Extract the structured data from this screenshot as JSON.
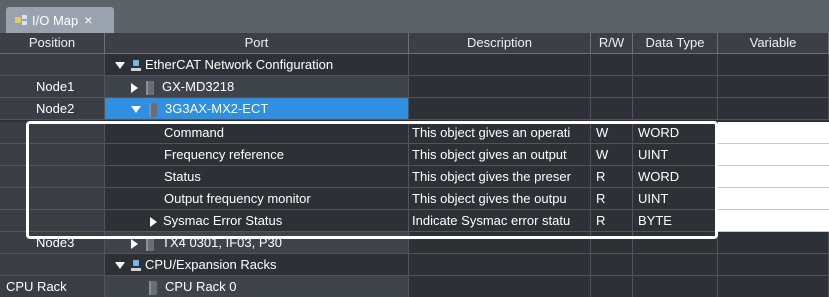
{
  "tab": {
    "label": "I/O Map",
    "close": "×",
    "icon": "io-map-icon"
  },
  "columns": [
    "Position",
    "Port",
    "Description",
    "R/W",
    "Data Type",
    "Variable"
  ],
  "rows": [
    {
      "position": "",
      "port": "EtherCAT Network Configuration",
      "description": "",
      "rw": "",
      "type": "",
      "kind": "group",
      "expander": "down"
    },
    {
      "position": "Node1",
      "port": "GX-MD3218",
      "description": "",
      "rw": "",
      "type": "",
      "kind": "device",
      "expander": "right"
    },
    {
      "position": "Node2",
      "port": "3G3AX-MX2-ECT",
      "description": "",
      "rw": "",
      "type": "",
      "kind": "device",
      "expander": "down",
      "selected": true
    },
    {
      "position": "",
      "port": "Command",
      "description": "This object gives an operati",
      "rw": "W",
      "type": "WORD",
      "kind": "object"
    },
    {
      "position": "",
      "port": "Frequency reference",
      "description": "This object gives an output",
      "rw": "W",
      "type": "UINT",
      "kind": "object"
    },
    {
      "position": "",
      "port": "Status",
      "description": "This object gives the preser",
      "rw": "R",
      "type": "WORD",
      "kind": "object"
    },
    {
      "position": "",
      "port": "Output frequency monitor",
      "description": "This object gives the outpu",
      "rw": "R",
      "type": "UINT",
      "kind": "object"
    },
    {
      "position": "",
      "port": "Sysmac Error Status",
      "description": "Indicate Sysmac error statu",
      "rw": "R",
      "type": "BYTE",
      "kind": "object",
      "expander": "right"
    },
    {
      "position": "Node3",
      "port": "TX4 0301, IF03, P30",
      "description": "",
      "rw": "",
      "type": "",
      "kind": "device",
      "expander": "right"
    },
    {
      "position": "",
      "port": "CPU/Expansion Racks",
      "description": "",
      "rw": "",
      "type": "",
      "kind": "group",
      "expander": "down"
    },
    {
      "position": "CPU Rack",
      "port": "CPU Rack 0",
      "description": "",
      "rw": "",
      "type": "",
      "kind": "device"
    }
  ],
  "colors": {
    "header": "#3c4046",
    "grid": "#2d3035",
    "selected": "#2f8fe0",
    "tab": "#9aa2ad"
  }
}
